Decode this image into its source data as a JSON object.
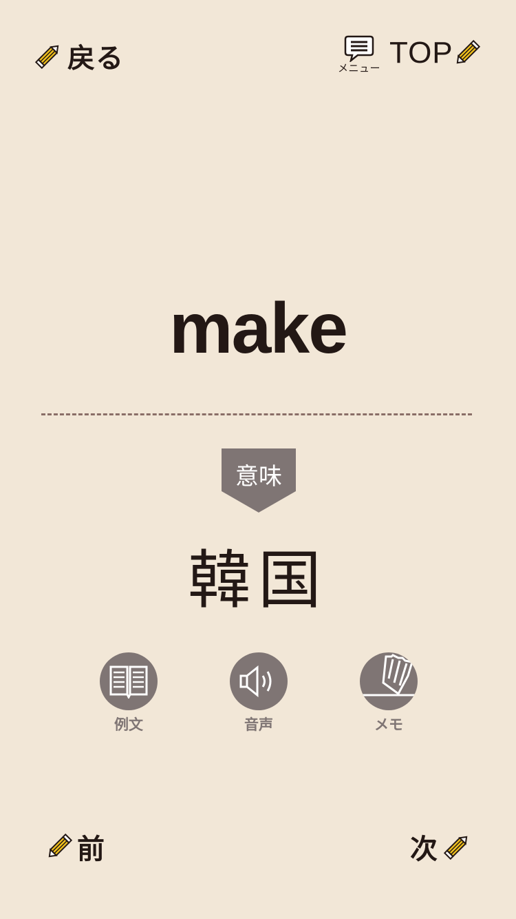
{
  "header": {
    "back_label": "戻る",
    "menu_label": "メニュー",
    "top_label": "TOP"
  },
  "card": {
    "word": "make",
    "meaning_badge": "意味",
    "meaning": "韓国"
  },
  "actions": [
    {
      "label": "例文",
      "icon": "book-icon"
    },
    {
      "label": "音声",
      "icon": "speaker-icon"
    },
    {
      "label": "メモ",
      "icon": "pencil-memo-icon"
    }
  ],
  "footer": {
    "prev_label": "前",
    "next_label": "次"
  },
  "colors": {
    "background": "#f2e7d7",
    "text": "#231815",
    "accent_gray": "#7f7574",
    "divider": "#8a6e67",
    "pencil_yellow": "#f2c21b"
  }
}
